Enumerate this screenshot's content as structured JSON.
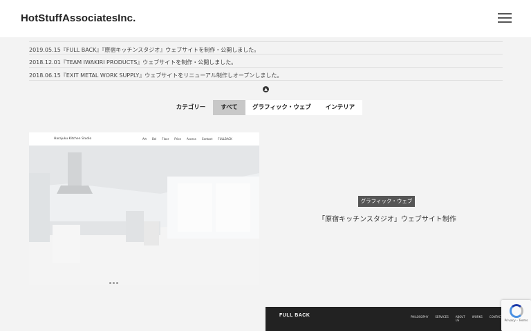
{
  "header": {
    "logo": "HotStuffAssociatesInc.",
    "menu_icon": "hamburger-icon"
  },
  "news": [
    {
      "text": "2019.05.15『FULL BACK』『原宿キッチンスタジオ』ウェブサイトを制作・公開しました。"
    },
    {
      "text": "2018.12.01『TEAM IWAKIRI PRODUCTS』ウェブサイトを制作・公開しました。"
    },
    {
      "text": "2018.06.15『EXIT METAL WORK SUPPLY』ウェブサイトをリニューアル制作しオープンしました。"
    }
  ],
  "toggle_icon": "chevron-up-circle-icon",
  "categories": {
    "label": "カテゴリー",
    "items": [
      "すべて",
      "グラフィック・ウェブ",
      "インテリア"
    ],
    "active": "すべて"
  },
  "post1": {
    "site_brand": "Harajuku Kitchen Studio",
    "site_links": [
      "Art",
      "Bel",
      "Floor",
      "Price",
      "Access",
      "Contact",
      "FULLBACK"
    ],
    "tag": "グラフィック・ウェブ",
    "title": "「原宿キッチンスタジオ」ウェブサイト制作"
  },
  "post2": {
    "site_brand": "FULL BACK",
    "site_links": [
      "PHILOSOPHY",
      "SERVICES",
      "ABOUT US",
      "WORKS",
      "CONTACT"
    ]
  },
  "recaptcha": {
    "text": "Privacy - Terms"
  }
}
